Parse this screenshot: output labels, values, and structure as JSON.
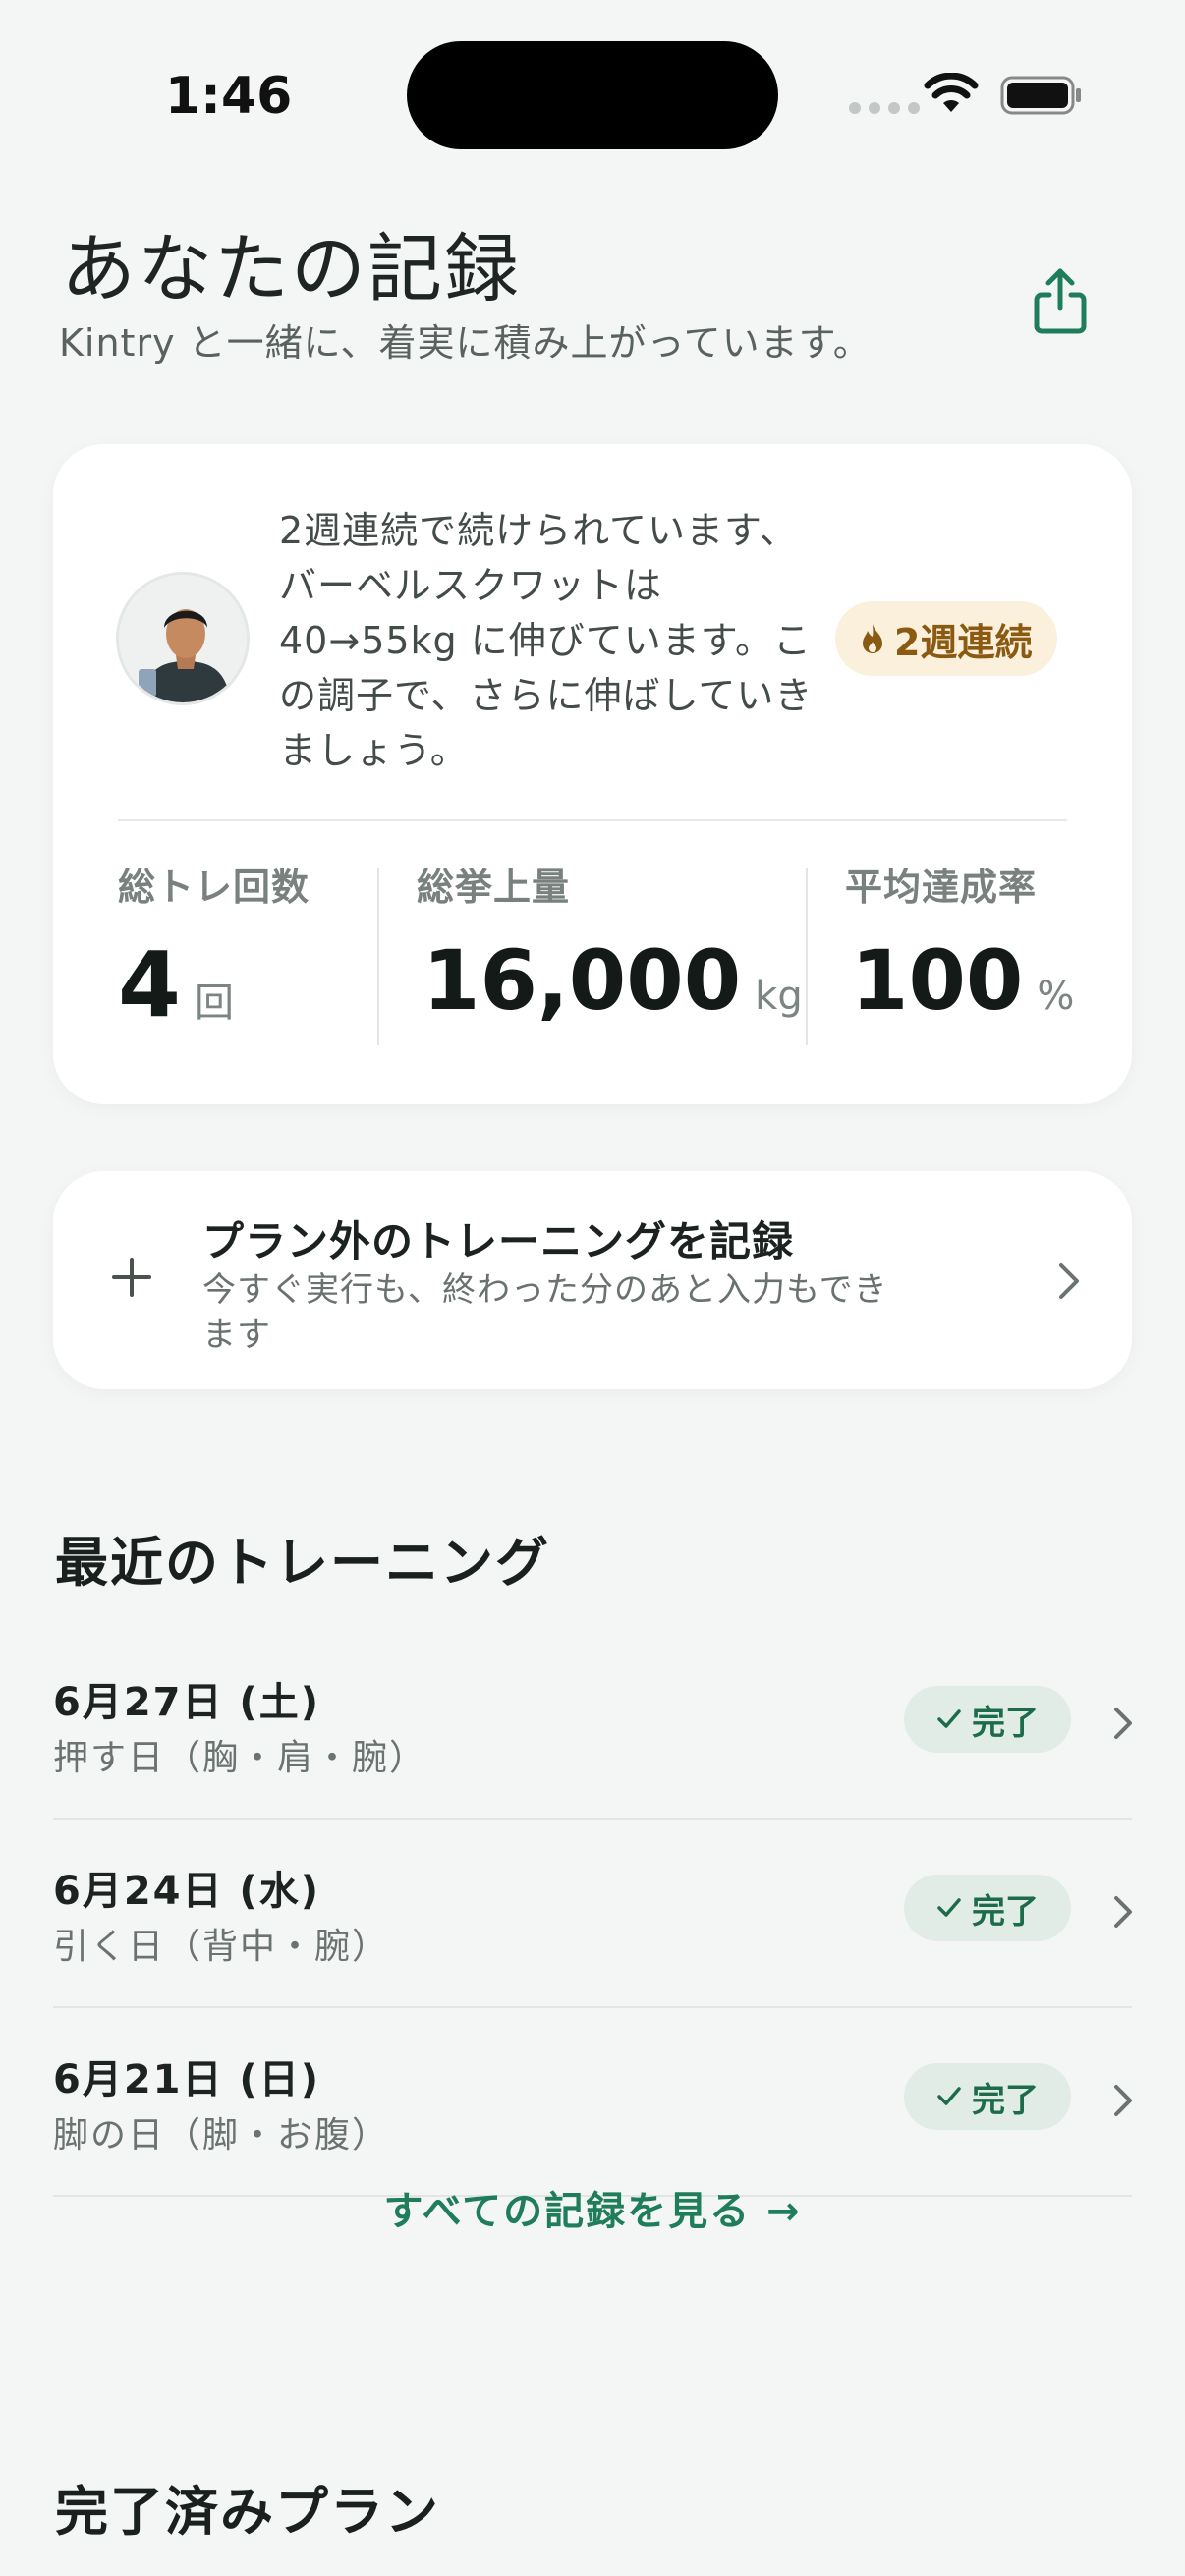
{
  "status_bar": {
    "time": "1:46"
  },
  "header": {
    "title": "あなたの記録",
    "subtitle": "Kintry と一緒に、着実に積み上がっています。"
  },
  "summary": {
    "coach_message": "2週連続で続けられています、バーベルスクワットは 40→55kg に伸びています。この調子で、さらに伸ばしていきましょう。",
    "streak_badge": "2週連続",
    "stats": [
      {
        "label": "総トレ回数",
        "value": "4",
        "unit": "回"
      },
      {
        "label": "総挙上量",
        "value": "16,000",
        "unit": "kg"
      },
      {
        "label": "平均達成率",
        "value": "100",
        "unit": "%"
      }
    ]
  },
  "record_card": {
    "title": "プラン外のトレーニングを記録",
    "description": "今すぐ実行も、終わった分のあと入力もできます"
  },
  "recent": {
    "title": "最近のトレーニング",
    "items": [
      {
        "date": "6月27日 (土)",
        "name": "押す日（胸・肩・腕）",
        "status": "完了"
      },
      {
        "date": "6月24日 (水)",
        "name": "引く日（背中・腕）",
        "status": "完了"
      },
      {
        "date": "6月21日 (日)",
        "name": "脚の日（脚・お腹）",
        "status": "完了"
      }
    ],
    "see_all": "すべての記録を見る →"
  },
  "completed_plans": {
    "title": "完了済みプラン"
  },
  "colors": {
    "accent": "#1f7d5c",
    "streak_bg": "#fbf0dc",
    "done_bg": "#e2ece6"
  }
}
